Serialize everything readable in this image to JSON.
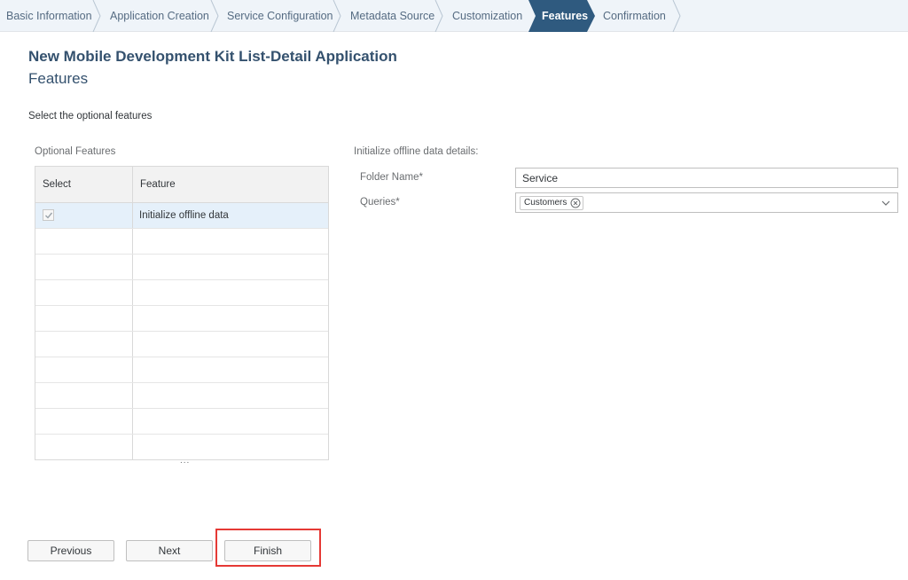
{
  "steps": [
    {
      "label": "Basic Information",
      "active": false
    },
    {
      "label": "Application Creation",
      "active": false
    },
    {
      "label": "Service Configuration",
      "active": false
    },
    {
      "label": "Metadata Source",
      "active": false
    },
    {
      "label": "Customization",
      "active": false
    },
    {
      "label": "Features",
      "active": true
    },
    {
      "label": "Confirmation",
      "active": false
    }
  ],
  "header": {
    "app_title": "New Mobile Development Kit List-Detail Application",
    "step_title": "Features"
  },
  "instruction": "Select the optional features",
  "features_table": {
    "section_label": "Optional Features",
    "columns": [
      "Select",
      "Feature"
    ],
    "rows": [
      {
        "selected": true,
        "feature": "Initialize offline data"
      }
    ],
    "more_indicator": "..."
  },
  "offline_details": {
    "section_label": "Initialize offline data details:",
    "folder_label": "Folder Name*",
    "folder_value": "Service",
    "queries_label": "Queries*",
    "query_tokens": [
      "Customers"
    ]
  },
  "buttons": {
    "previous": "Previous",
    "next": "Next",
    "finish": "Finish"
  },
  "colors": {
    "active_step": "#2f5a7f",
    "step_bar_bg": "#eff4f9",
    "title": "#34516e",
    "selected_row": "#e5f0fa",
    "highlight": "#e53935"
  },
  "icons": {
    "checkbox": "check-icon",
    "token_remove": "close-circle-icon",
    "dropdown": "chevron-down-icon"
  }
}
